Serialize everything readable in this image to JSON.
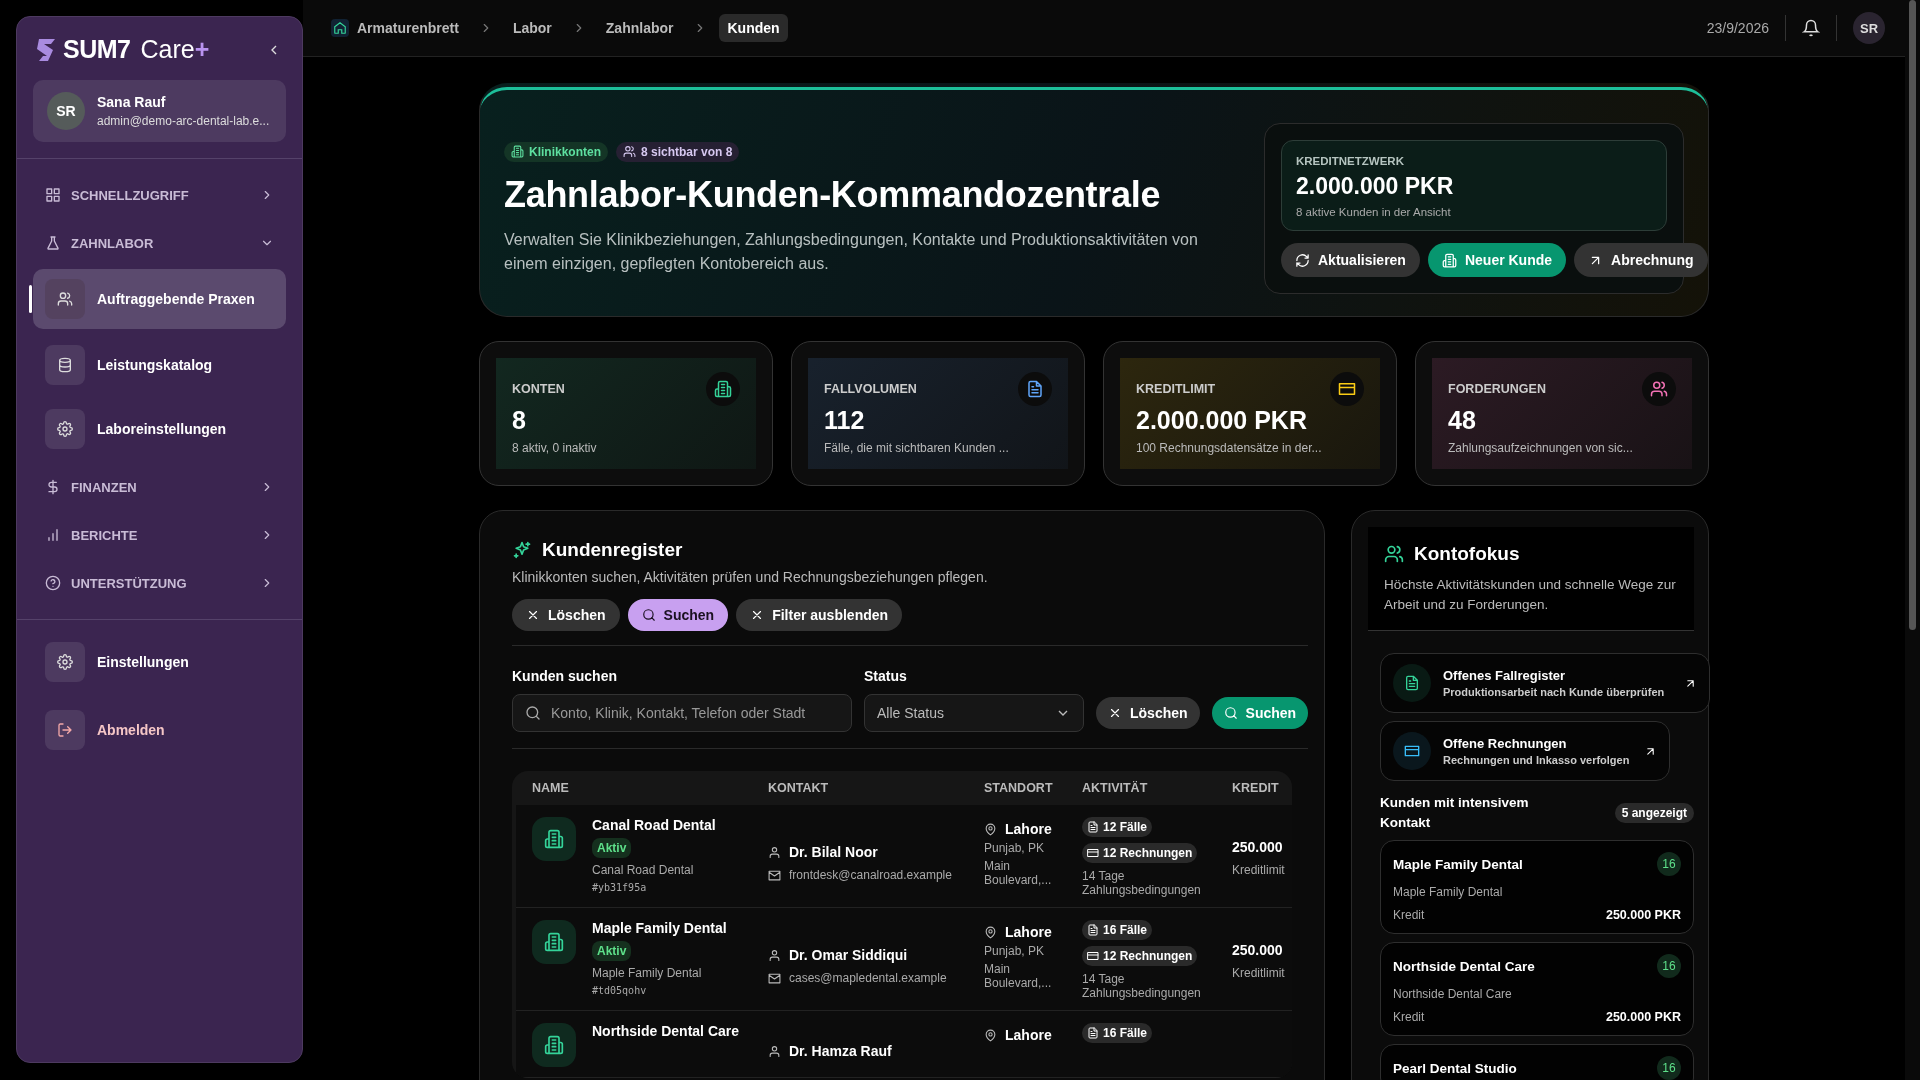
{
  "sidebar": {
    "brand": {
      "name": "SUM7",
      "product": "Care",
      "mark": "+"
    },
    "user": {
      "initials": "SR",
      "name": "Sana Rauf",
      "email": "admin@demo-arc-dental-lab.e..."
    },
    "nav": [
      {
        "label": "SCHNELLZUGRIFF",
        "expanded": false
      },
      {
        "label": "ZAHNLABOR",
        "expanded": true,
        "children": [
          {
            "label": "Auftraggebende Praxen",
            "selected": true
          },
          {
            "label": "Leistungskatalog",
            "selected": false
          },
          {
            "label": "Laboreinstellungen",
            "selected": false
          }
        ]
      },
      {
        "label": "FINANZEN",
        "expanded": false
      },
      {
        "label": "BERICHTE",
        "expanded": false
      },
      {
        "label": "UNTERSTÜTZUNG",
        "expanded": false
      }
    ],
    "footer": [
      {
        "label": "Einstellungen",
        "kind": "settings"
      },
      {
        "label": "Abmelden",
        "kind": "logout"
      }
    ]
  },
  "header": {
    "breadcrumbs": [
      {
        "label": "Armaturenbrett",
        "selected": false
      },
      {
        "label": "Labor",
        "selected": false
      },
      {
        "label": "Zahnlabor",
        "selected": false
      },
      {
        "label": "Kunden",
        "selected": true
      }
    ],
    "date": "23/9/2026",
    "avatar": "SR"
  },
  "hero": {
    "tags": [
      "Klinikkonten",
      "8 sichtbar von 8"
    ],
    "title": "Zahnlabor-Kunden-Kommandozentrale",
    "description": "Verwalten Sie Klinikbeziehungen, Zahlungsbedingungen, Kontakte und Produktionsaktivitäten von einem einzigen, gepflegten Kontobereich aus.",
    "network": {
      "label": "KREDITNETZWERK",
      "value": "2.000.000 PKR",
      "note": "8 aktive Kunden in der Ansicht"
    },
    "buttons": [
      {
        "label": "Aktualisieren",
        "kind": "refresh"
      },
      {
        "label": "Neuer Kunde",
        "kind": "primary"
      },
      {
        "label": "Abrechnung",
        "kind": "link"
      }
    ]
  },
  "stats": [
    {
      "label": "KONTEN",
      "value": "8",
      "note": "8 aktiv, 0 inaktiv",
      "color": "#34d399"
    },
    {
      "label": "FALLVOLUMEN",
      "value": "112",
      "note": "Fälle, die mit sichtbaren Kunden ...",
      "color": "#60a5fa"
    },
    {
      "label": "KREDITLIMIT",
      "value": "2.000.000 PKR",
      "note": "100 Rechnungsdatensätze in der...",
      "color": "#facc15"
    },
    {
      "label": "FORDERUNGEN",
      "value": "48",
      "note": "Zahlungsaufzeichnungen von sic...",
      "color": "#f472b6"
    }
  ],
  "register": {
    "title": "Kundenregister",
    "subtitle": "Klinikkonten suchen, Aktivitäten prüfen und Rechnungsbeziehungen pflegen.",
    "chips": [
      {
        "label": "Löschen",
        "kind": "clear"
      },
      {
        "label": "Suchen",
        "kind": "search"
      },
      {
        "label": "Filter ausblenden",
        "kind": "clear"
      }
    ],
    "search": {
      "label": "Kunden suchen",
      "placeholder": "Konto, Klinik, Kontakt, Telefon oder Stadt"
    },
    "status": {
      "label": "Status",
      "value": "Alle Status"
    },
    "buttons": [
      {
        "label": "Löschen",
        "kind": "clear"
      },
      {
        "label": "Suchen",
        "kind": "primary"
      }
    ],
    "table": {
      "columns": [
        "NAME",
        "KONTAKT",
        "STANDORT",
        "AKTIVITÄT",
        "KREDIT"
      ],
      "rows": [
        {
          "name": "Canal Road Dental",
          "status": "Aktiv",
          "clinic": "Canal Road Dental",
          "code": "#yb31f95a",
          "contact": "Dr. Bilal Noor",
          "email": "frontdesk@canalroad.example",
          "city": "Lahore",
          "region": "Punjab, PK",
          "street": "Main Boulevard,...",
          "cases": "12 Fälle",
          "invoices": "12 Rechnungen",
          "terms": "14 Tage Zahlungsbedingungen",
          "credit": "250.000",
          "credit_label": "Kreditlimit"
        },
        {
          "name": "Maple Family Dental",
          "status": "Aktiv",
          "clinic": "Maple Family Dental",
          "code": "#td05qohv",
          "contact": "Dr. Omar Siddiqui",
          "email": "cases@mapledental.example",
          "city": "Lahore",
          "region": "Punjab, PK",
          "street": "Main Boulevard,...",
          "cases": "16 Fälle",
          "invoices": "12 Rechnungen",
          "terms": "14 Tage Zahlungsbedingungen",
          "credit": "250.000",
          "credit_label": "Kreditlimit"
        },
        {
          "name": "Northside Dental Care",
          "contact": "Dr. Hamza Rauf",
          "city": "Lahore",
          "cases": "16 Fälle"
        }
      ]
    }
  },
  "focus": {
    "title": "Kontofokus",
    "description": "Höchste Aktivitätskunden und schnelle Wege zur Arbeit und zu Forderungen.",
    "links": [
      {
        "title": "Offenes Fallregister",
        "subtitle": "Produktionsarbeit nach Kunde überprüfen",
        "color": "#34d399"
      },
      {
        "title": "Offene Rechnungen",
        "subtitle": "Rechnungen und Inkasso verfolgen",
        "color": "#38bdf8"
      }
    ],
    "heading": "Kunden mit intensivem Kontakt",
    "badge": "5 angezeigt",
    "clients": [
      {
        "name": "Maple Family Dental",
        "count": "16",
        "clinic": "Maple Family Dental",
        "credit_label": "Kredit",
        "credit": "250.000 PKR"
      },
      {
        "name": "Northside Dental Care",
        "count": "16",
        "clinic": "Northside Dental Care",
        "credit_label": "Kredit",
        "credit": "250.000 PKR"
      },
      {
        "name": "Pearl Dental Studio",
        "count": "16"
      }
    ]
  }
}
